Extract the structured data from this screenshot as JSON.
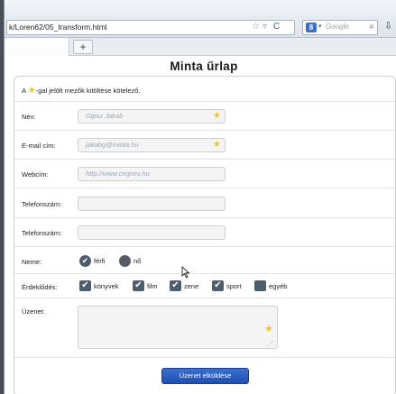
{
  "browser": {
    "url": "k/Loren62/05_transform.html",
    "search_placeholder": "Google",
    "search_engine_glyph": "8",
    "new_tab": "+"
  },
  "page": {
    "title": "Minta űrlap",
    "required_note_prefix": "A ",
    "required_note_suffix": "-gal jelölt mezők kitöltése kötelező."
  },
  "form": {
    "name": {
      "label": "Név:",
      "placeholder": "Gipsz Jakab",
      "required": true
    },
    "email": {
      "label": "E-mail cím:",
      "placeholder": "jakabg@minta.hu",
      "required": true
    },
    "web": {
      "label": "Webcím:",
      "placeholder": "http://www.cegnev.hu"
    },
    "phone1": {
      "label": "Telefonszám:",
      "value": ""
    },
    "phone2": {
      "label": "Telefonszám:",
      "value": ""
    },
    "gender": {
      "label": "Neme:",
      "options": [
        {
          "label": "férfi",
          "selected": true
        },
        {
          "label": "nő",
          "selected": false
        }
      ]
    },
    "interests": {
      "label": "Érdeklődés:",
      "options": [
        {
          "label": "könyvek",
          "checked": true
        },
        {
          "label": "film",
          "checked": true
        },
        {
          "label": "zene",
          "checked": true
        },
        {
          "label": "sport",
          "checked": true
        },
        {
          "label": "egyéb",
          "checked": false
        }
      ]
    },
    "message": {
      "label": "Üzenet:",
      "value": ""
    },
    "submit_label": "Üzenet elküldése"
  },
  "icons": {
    "required": "star-icon",
    "check": "checkmark-icon",
    "search": "magnifier-icon",
    "download": "download-arrow-icon",
    "reload": "reload-icon"
  },
  "colors": {
    "required_star": "#f0c22e",
    "submit_button": "#2a5cc0",
    "checkbox": "#4e5d6c"
  }
}
